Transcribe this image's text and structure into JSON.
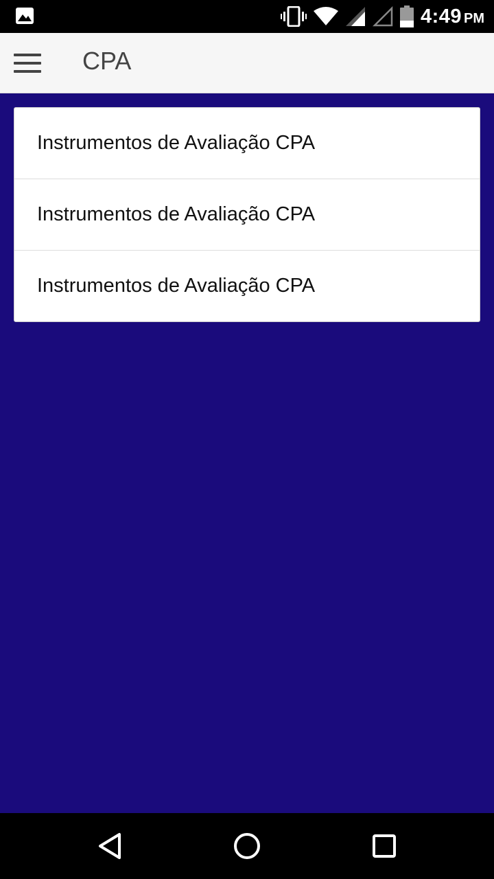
{
  "status_bar": {
    "time": "4:49",
    "ampm": "PM",
    "icons": [
      "image-icon",
      "vibrate-icon",
      "wifi-icon",
      "signal-icon",
      "signal-empty-icon",
      "battery-icon"
    ]
  },
  "app_bar": {
    "title": "CPA",
    "menu_icon": "hamburger-menu-icon"
  },
  "list": {
    "items": [
      {
        "label": "Instrumentos de Avaliação CPA"
      },
      {
        "label": "Instrumentos de Avaliação CPA"
      },
      {
        "label": "Instrumentos de Avaliação CPA"
      }
    ]
  },
  "nav_bar": {
    "buttons": [
      "back-icon",
      "home-icon",
      "recents-icon"
    ]
  },
  "colors": {
    "background": "#1a0b7c",
    "app_bar": "#f6f6f6",
    "card": "#ffffff"
  }
}
